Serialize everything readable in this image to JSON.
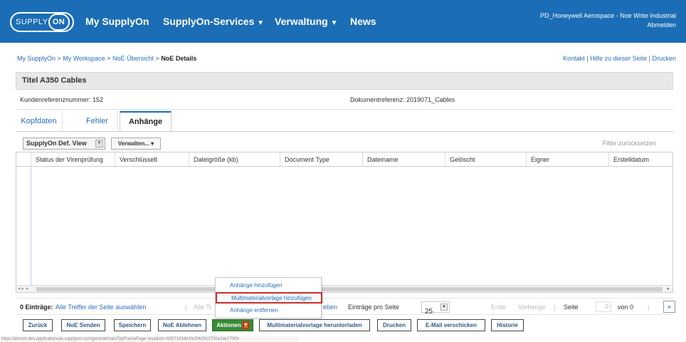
{
  "topbar": {
    "logo_text": "SUPPLY",
    "logo_on": "ON",
    "nav": [
      {
        "label": "My SupplyOn",
        "caret": ""
      },
      {
        "label": "SupplyOn-Services",
        "caret": "▼"
      },
      {
        "label": "Verwaltung",
        "caret": "▼"
      },
      {
        "label": "News",
        "caret": ""
      }
    ],
    "user_line": "PD_Honeywell Aerospace - Noe Write Industrial",
    "logout": "Abmelden",
    "color": "#1b6db5"
  },
  "breadcrumb": {
    "items": [
      "My SupplyOn",
      "My Workspace",
      "NoE Übersicht"
    ],
    "separator": ">",
    "current": "NoE Details"
  },
  "toplinks": {
    "kontakt": "Kontakt",
    "hilfe": "Hilfe zu dieser Seite",
    "drucken": "Drucken",
    "sep": "|"
  },
  "title": "Titel A350 Cables",
  "refs": {
    "kunden": "Kundenreferenznummer: 152",
    "dokument": "Dokumentreferenz: 2019071_Cables"
  },
  "tabs": [
    {
      "label": "Kopfdaten",
      "active": false
    },
    {
      "label": "Fehler",
      "active": false
    },
    {
      "label": "Anhänge",
      "active": true
    }
  ],
  "toolbar": {
    "view_select": "SupplyOn Def. View",
    "verwalten": "Verwalten... ▾",
    "filter_reset": "Filter zurücksetzen"
  },
  "grid": {
    "columns": [
      "Status der Virenprüfung",
      "Verschlüsselt",
      "Dateigröße (kb)",
      "Document Type",
      "Dateiname",
      "Gelöscht",
      "Eigner",
      "Erstelldatum"
    ],
    "rows": []
  },
  "menu": {
    "items": [
      "Anhänge hinzufügen",
      "Multimaterialvorlage hinzufügen",
      "Anhänge entfernen"
    ],
    "highlighted_index": 1
  },
  "pager": {
    "count": "0 Einträge:",
    "select_all": "Alle Treffer der Seite auswählen",
    "sep": "|",
    "partial_a": "Alle Tr",
    "partial_b": "eben",
    "per_page_label": "Einträge pro Seite",
    "per_page_value": "25",
    "first": "Erste",
    "prev": "Vorherige",
    "page_label": "Seite",
    "page_value": "0",
    "of": "von 0",
    "next": "»"
  },
  "buttons": [
    {
      "label": "Zurück",
      "style": "normal"
    },
    {
      "label": "NoE Senden",
      "style": "normal"
    },
    {
      "label": "Speichern",
      "style": "normal"
    },
    {
      "label": "NoE Ablehnen",
      "style": "normal"
    },
    {
      "label": "Aktionen",
      "style": "green"
    },
    {
      "label": "Multimaterialvorlage herunterladen",
      "style": "normal"
    },
    {
      "label": "Drucken",
      "style": "normal"
    },
    {
      "label": "E-Mail verschicken",
      "style": "normal"
    },
    {
      "label": "Historie",
      "style": "normal"
    }
  ],
  "status_url": "https://airscm-dev.applicationuas.supplyon.com/general/mainTopFramePage~true&stn~b0071834b1fe2f4d2fc3720e2de7700#"
}
